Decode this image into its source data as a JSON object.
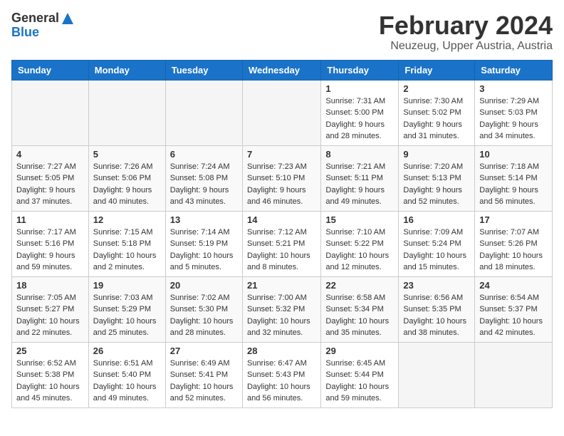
{
  "logo": {
    "general": "General",
    "blue": "Blue"
  },
  "header": {
    "month": "February 2024",
    "location": "Neuzeug, Upper Austria, Austria"
  },
  "days_of_week": [
    "Sunday",
    "Monday",
    "Tuesday",
    "Wednesday",
    "Thursday",
    "Friday",
    "Saturday"
  ],
  "weeks": [
    [
      {
        "day": "",
        "sunrise": "",
        "sunset": "",
        "daylight": ""
      },
      {
        "day": "",
        "sunrise": "",
        "sunset": "",
        "daylight": ""
      },
      {
        "day": "",
        "sunrise": "",
        "sunset": "",
        "daylight": ""
      },
      {
        "day": "",
        "sunrise": "",
        "sunset": "",
        "daylight": ""
      },
      {
        "day": "1",
        "sunrise": "Sunrise: 7:31 AM",
        "sunset": "Sunset: 5:00 PM",
        "daylight": "Daylight: 9 hours and 28 minutes."
      },
      {
        "day": "2",
        "sunrise": "Sunrise: 7:30 AM",
        "sunset": "Sunset: 5:02 PM",
        "daylight": "Daylight: 9 hours and 31 minutes."
      },
      {
        "day": "3",
        "sunrise": "Sunrise: 7:29 AM",
        "sunset": "Sunset: 5:03 PM",
        "daylight": "Daylight: 9 hours and 34 minutes."
      }
    ],
    [
      {
        "day": "4",
        "sunrise": "Sunrise: 7:27 AM",
        "sunset": "Sunset: 5:05 PM",
        "daylight": "Daylight: 9 hours and 37 minutes."
      },
      {
        "day": "5",
        "sunrise": "Sunrise: 7:26 AM",
        "sunset": "Sunset: 5:06 PM",
        "daylight": "Daylight: 9 hours and 40 minutes."
      },
      {
        "day": "6",
        "sunrise": "Sunrise: 7:24 AM",
        "sunset": "Sunset: 5:08 PM",
        "daylight": "Daylight: 9 hours and 43 minutes."
      },
      {
        "day": "7",
        "sunrise": "Sunrise: 7:23 AM",
        "sunset": "Sunset: 5:10 PM",
        "daylight": "Daylight: 9 hours and 46 minutes."
      },
      {
        "day": "8",
        "sunrise": "Sunrise: 7:21 AM",
        "sunset": "Sunset: 5:11 PM",
        "daylight": "Daylight: 9 hours and 49 minutes."
      },
      {
        "day": "9",
        "sunrise": "Sunrise: 7:20 AM",
        "sunset": "Sunset: 5:13 PM",
        "daylight": "Daylight: 9 hours and 52 minutes."
      },
      {
        "day": "10",
        "sunrise": "Sunrise: 7:18 AM",
        "sunset": "Sunset: 5:14 PM",
        "daylight": "Daylight: 9 hours and 56 minutes."
      }
    ],
    [
      {
        "day": "11",
        "sunrise": "Sunrise: 7:17 AM",
        "sunset": "Sunset: 5:16 PM",
        "daylight": "Daylight: 9 hours and 59 minutes."
      },
      {
        "day": "12",
        "sunrise": "Sunrise: 7:15 AM",
        "sunset": "Sunset: 5:18 PM",
        "daylight": "Daylight: 10 hours and 2 minutes."
      },
      {
        "day": "13",
        "sunrise": "Sunrise: 7:14 AM",
        "sunset": "Sunset: 5:19 PM",
        "daylight": "Daylight: 10 hours and 5 minutes."
      },
      {
        "day": "14",
        "sunrise": "Sunrise: 7:12 AM",
        "sunset": "Sunset: 5:21 PM",
        "daylight": "Daylight: 10 hours and 8 minutes."
      },
      {
        "day": "15",
        "sunrise": "Sunrise: 7:10 AM",
        "sunset": "Sunset: 5:22 PM",
        "daylight": "Daylight: 10 hours and 12 minutes."
      },
      {
        "day": "16",
        "sunrise": "Sunrise: 7:09 AM",
        "sunset": "Sunset: 5:24 PM",
        "daylight": "Daylight: 10 hours and 15 minutes."
      },
      {
        "day": "17",
        "sunrise": "Sunrise: 7:07 AM",
        "sunset": "Sunset: 5:26 PM",
        "daylight": "Daylight: 10 hours and 18 minutes."
      }
    ],
    [
      {
        "day": "18",
        "sunrise": "Sunrise: 7:05 AM",
        "sunset": "Sunset: 5:27 PM",
        "daylight": "Daylight: 10 hours and 22 minutes."
      },
      {
        "day": "19",
        "sunrise": "Sunrise: 7:03 AM",
        "sunset": "Sunset: 5:29 PM",
        "daylight": "Daylight: 10 hours and 25 minutes."
      },
      {
        "day": "20",
        "sunrise": "Sunrise: 7:02 AM",
        "sunset": "Sunset: 5:30 PM",
        "daylight": "Daylight: 10 hours and 28 minutes."
      },
      {
        "day": "21",
        "sunrise": "Sunrise: 7:00 AM",
        "sunset": "Sunset: 5:32 PM",
        "daylight": "Daylight: 10 hours and 32 minutes."
      },
      {
        "day": "22",
        "sunrise": "Sunrise: 6:58 AM",
        "sunset": "Sunset: 5:34 PM",
        "daylight": "Daylight: 10 hours and 35 minutes."
      },
      {
        "day": "23",
        "sunrise": "Sunrise: 6:56 AM",
        "sunset": "Sunset: 5:35 PM",
        "daylight": "Daylight: 10 hours and 38 minutes."
      },
      {
        "day": "24",
        "sunrise": "Sunrise: 6:54 AM",
        "sunset": "Sunset: 5:37 PM",
        "daylight": "Daylight: 10 hours and 42 minutes."
      }
    ],
    [
      {
        "day": "25",
        "sunrise": "Sunrise: 6:52 AM",
        "sunset": "Sunset: 5:38 PM",
        "daylight": "Daylight: 10 hours and 45 minutes."
      },
      {
        "day": "26",
        "sunrise": "Sunrise: 6:51 AM",
        "sunset": "Sunset: 5:40 PM",
        "daylight": "Daylight: 10 hours and 49 minutes."
      },
      {
        "day": "27",
        "sunrise": "Sunrise: 6:49 AM",
        "sunset": "Sunset: 5:41 PM",
        "daylight": "Daylight: 10 hours and 52 minutes."
      },
      {
        "day": "28",
        "sunrise": "Sunrise: 6:47 AM",
        "sunset": "Sunset: 5:43 PM",
        "daylight": "Daylight: 10 hours and 56 minutes."
      },
      {
        "day": "29",
        "sunrise": "Sunrise: 6:45 AM",
        "sunset": "Sunset: 5:44 PM",
        "daylight": "Daylight: 10 hours and 59 minutes."
      },
      {
        "day": "",
        "sunrise": "",
        "sunset": "",
        "daylight": ""
      },
      {
        "day": "",
        "sunrise": "",
        "sunset": "",
        "daylight": ""
      }
    ]
  ]
}
